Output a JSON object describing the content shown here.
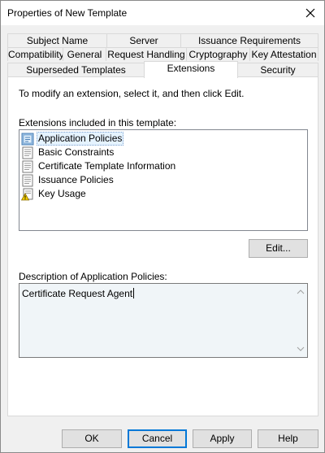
{
  "window": {
    "title": "Properties of New Template"
  },
  "tabs": {
    "row1": [
      "Subject Name",
      "Server",
      "Issuance Requirements"
    ],
    "row2": [
      "Compatibility",
      "General",
      "Request Handling",
      "Cryptography",
      "Key Attestation"
    ],
    "row3": [
      "Superseded Templates",
      "Extensions",
      "Security"
    ],
    "active": "Extensions"
  },
  "panel": {
    "instruction": "To modify an extension, select it, and then click Edit.",
    "extensions_label": "Extensions included in this template:",
    "extensions": [
      {
        "label": "Application Policies",
        "icon": "document-icon",
        "selected": true
      },
      {
        "label": "Basic Constraints",
        "icon": "document-icon",
        "selected": false
      },
      {
        "label": "Certificate Template Information",
        "icon": "document-icon",
        "selected": false
      },
      {
        "label": "Issuance Policies",
        "icon": "document-icon",
        "selected": false
      },
      {
        "label": "Key Usage",
        "icon": "warning-document-icon",
        "selected": false
      }
    ],
    "edit_button": "Edit...",
    "description_label": "Description of Application Policies:",
    "description_value": "Certificate Request Agent"
  },
  "buttons": {
    "ok": "OK",
    "cancel": "Cancel",
    "apply": "Apply",
    "help": "Help"
  },
  "colors": {
    "accent": "#0078d7",
    "selection": "#e5f3ff"
  }
}
